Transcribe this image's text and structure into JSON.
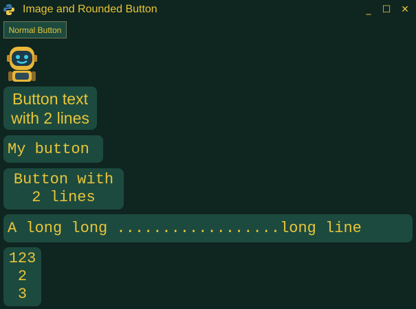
{
  "window": {
    "title": "Image and Rounded Button",
    "minimize_glyph": "_",
    "maximize_glyph": "☐",
    "close_glyph": "✕"
  },
  "buttons": {
    "normal": "Normal Button",
    "two_line_sans": [
      "Button text",
      "with 2 lines"
    ],
    "my_button": "My button",
    "two_line_mono": [
      "Button with",
      "2 lines"
    ],
    "long_line": "A long long ..................long line",
    "multi_line": [
      "123",
      "2",
      "3"
    ]
  },
  "colors": {
    "background": "#0f2520",
    "button_bg": "#1d4a3e",
    "text": "#e8c53a"
  }
}
